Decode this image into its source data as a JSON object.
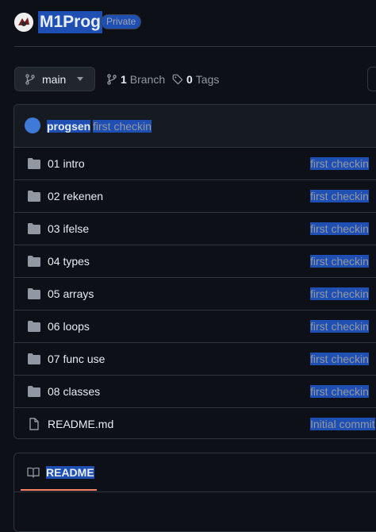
{
  "repo": {
    "name": "M1Prog",
    "visibility": "Private"
  },
  "branch_bar": {
    "current_branch": "main",
    "branch_count": "1",
    "branch_label": "Branch",
    "tag_count": "0",
    "tag_label": "Tags"
  },
  "latest_commit": {
    "author": "progsen",
    "message": "first checkin"
  },
  "files": [
    {
      "name": "01 intro",
      "type": "folder",
      "message": "first checkin"
    },
    {
      "name": "02 rekenen",
      "type": "folder",
      "message": "first checkin"
    },
    {
      "name": "03 ifelse",
      "type": "folder",
      "message": "first checkin"
    },
    {
      "name": "04 types",
      "type": "folder",
      "message": "first checkin"
    },
    {
      "name": "05 arrays",
      "type": "folder",
      "message": "first checkin"
    },
    {
      "name": "06 loops",
      "type": "folder",
      "message": "first checkin"
    },
    {
      "name": "07 func use",
      "type": "folder",
      "message": "first checkin"
    },
    {
      "name": "08 classes",
      "type": "folder",
      "message": "first checkin"
    },
    {
      "name": "README.md",
      "type": "file",
      "message": "Initial commit"
    }
  ],
  "readme": {
    "tab_label": "README"
  },
  "colors": {
    "background": "#0d1117",
    "selection": "#1f4fb3",
    "accent_underline": "#f78166"
  }
}
